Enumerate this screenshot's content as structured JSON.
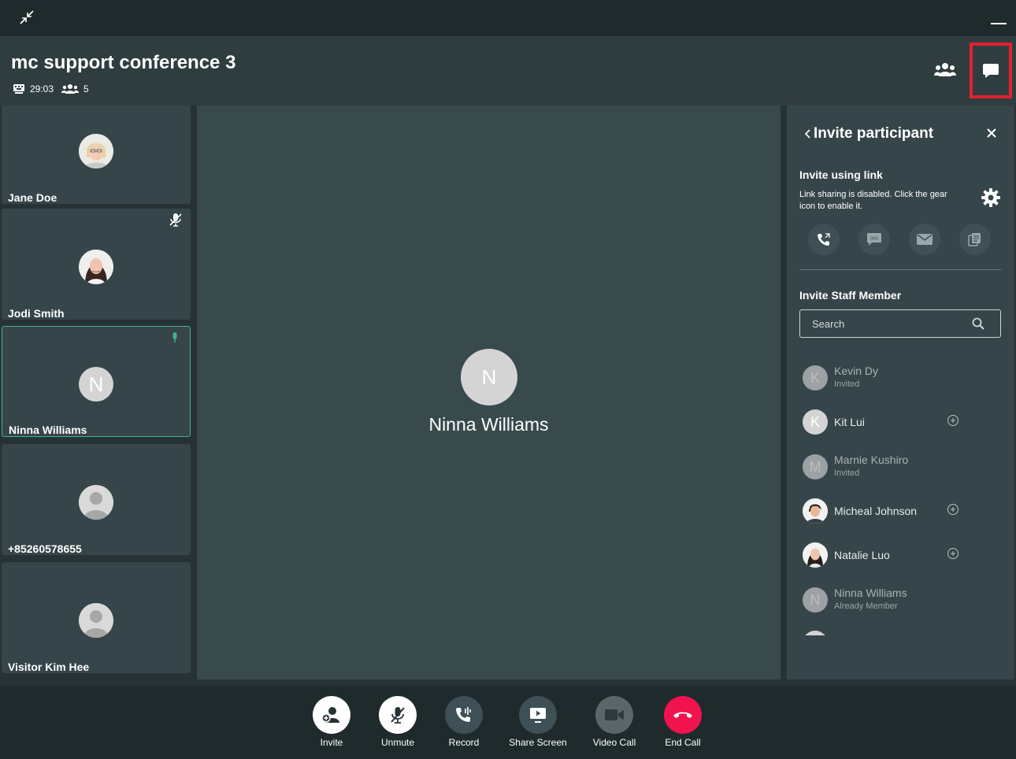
{
  "header": {
    "title": "mc support conference 3",
    "duration": "29:03",
    "participant_count": "5"
  },
  "participants": [
    {
      "name": "Jane Doe"
    },
    {
      "name": "Jodi Smith"
    },
    {
      "name": "Ninna Williams",
      "initial": "N"
    },
    {
      "name": "+85260578655"
    },
    {
      "name": "Visitor Kim Hee"
    }
  ],
  "stage": {
    "initial": "N",
    "name": "Ninna Williams"
  },
  "panel": {
    "title": "Invite participant",
    "invite_link_heading": "Invite using link",
    "invite_link_note": "Link sharing is disabled. Click the gear icon to enable it.",
    "staff_heading": "Invite Staff Member",
    "search_placeholder": "Search",
    "staff": [
      {
        "name": "Kevin Dy",
        "initial": "K",
        "status": "Invited"
      },
      {
        "name": "Kit Lui",
        "initial": "K",
        "status": ""
      },
      {
        "name": "Marnie Kushiro",
        "initial": "M",
        "status": "Invited"
      },
      {
        "name": "Micheal Johnson",
        "status": ""
      },
      {
        "name": "Natalie Luo",
        "status": ""
      },
      {
        "name": "Ninna Williams",
        "initial": "N",
        "status": "Already Member"
      }
    ]
  },
  "controls": {
    "invite": "Invite",
    "unmute": "Unmute",
    "record": "Record",
    "share_screen": "Share Screen",
    "video_call": "Video Call",
    "end_call": "End Call"
  },
  "colors": {
    "active_border": "#3fb589",
    "end_call": "#f0134d",
    "highlight": "#e5202e"
  }
}
